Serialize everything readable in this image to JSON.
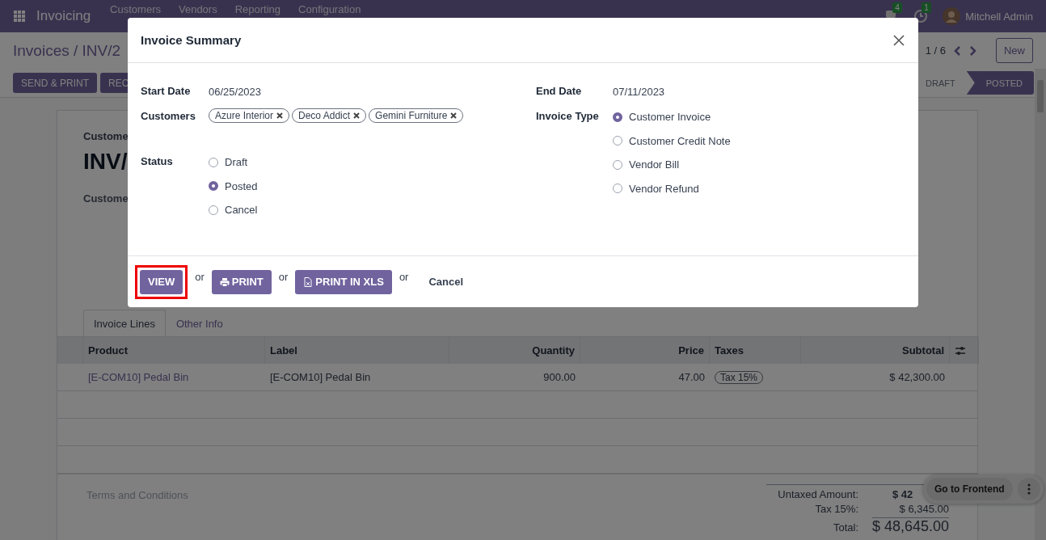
{
  "navbar": {
    "app": "Invoicing",
    "menu": [
      "Customers",
      "Vendors",
      "Reporting",
      "Configuration"
    ],
    "notifications": [
      {
        "kind": "chat",
        "count": "4"
      },
      {
        "kind": "activity",
        "count": "1"
      }
    ],
    "user": "Mitchell Admin"
  },
  "control_panel": {
    "breadcrumb": "Invoices / INV/2",
    "actions": [
      "SEND & PRINT",
      "REC"
    ],
    "pager": "1 / 6",
    "new_button": "New",
    "statuses": [
      {
        "label": "DRAFT",
        "selected": false
      },
      {
        "label": "POSTED",
        "selected": true
      }
    ]
  },
  "sheet": {
    "partner_label": "Custome",
    "title": "INV/",
    "field_label": "Custome",
    "tabs": [
      {
        "label": "Invoice Lines",
        "selected": true
      },
      {
        "label": "Other Info",
        "selected": false
      }
    ],
    "table": {
      "columns": [
        "Product",
        "Label",
        "Quantity",
        "Price",
        "Taxes",
        "Subtotal"
      ],
      "rows": [
        {
          "product": "[E-COM10] Pedal Bin",
          "label": "[E-COM10] Pedal Bin",
          "quantity": "900.00",
          "price": "47.00",
          "taxes": [
            "Tax 15%"
          ],
          "subtotal": "$ 42,300.00"
        }
      ]
    },
    "terms_placeholder": "Terms and Conditions",
    "totals": [
      {
        "kind": "untaxed",
        "label": "Untaxed Amount:",
        "value": "$ 42"
      },
      {
        "kind": "tax",
        "label": "Tax 15%:",
        "value": "$ 6,345.00"
      },
      {
        "kind": "total",
        "label": "Total:",
        "value": "$ 48,645.00"
      }
    ]
  },
  "frontend_button": "Go to Frontend",
  "dialog": {
    "title": "Invoice Summary",
    "start_date": {
      "label": "Start Date",
      "value": "06/25/2023"
    },
    "end_date": {
      "label": "End Date",
      "value": "07/11/2023"
    },
    "customers": {
      "label": "Customers",
      "tags": [
        "Azure Interior",
        "Deco Addict",
        "Gemini Furniture"
      ]
    },
    "status": {
      "label": "Status",
      "options": [
        {
          "label": "Draft",
          "selected": false
        },
        {
          "label": "Posted",
          "selected": true
        },
        {
          "label": "Cancel",
          "selected": false
        }
      ]
    },
    "invoice_type": {
      "label": "Invoice Type",
      "options": [
        {
          "label": "Customer Invoice",
          "selected": true
        },
        {
          "label": "Customer Credit Note",
          "selected": false
        },
        {
          "label": "Vendor Bill",
          "selected": false
        },
        {
          "label": "Vendor Refund",
          "selected": false
        }
      ]
    },
    "footer": [
      {
        "kind": "primary",
        "label": "VIEW",
        "highlighted": true
      },
      {
        "kind": "or",
        "label": "or"
      },
      {
        "kind": "print",
        "label": "PRINT",
        "highlighted": false
      },
      {
        "kind": "or",
        "label": "or"
      },
      {
        "kind": "export",
        "label": "PRINT IN XLS",
        "highlighted": false
      },
      {
        "kind": "or",
        "label": "or"
      },
      {
        "kind": "link",
        "label": "Cancel"
      }
    ]
  }
}
